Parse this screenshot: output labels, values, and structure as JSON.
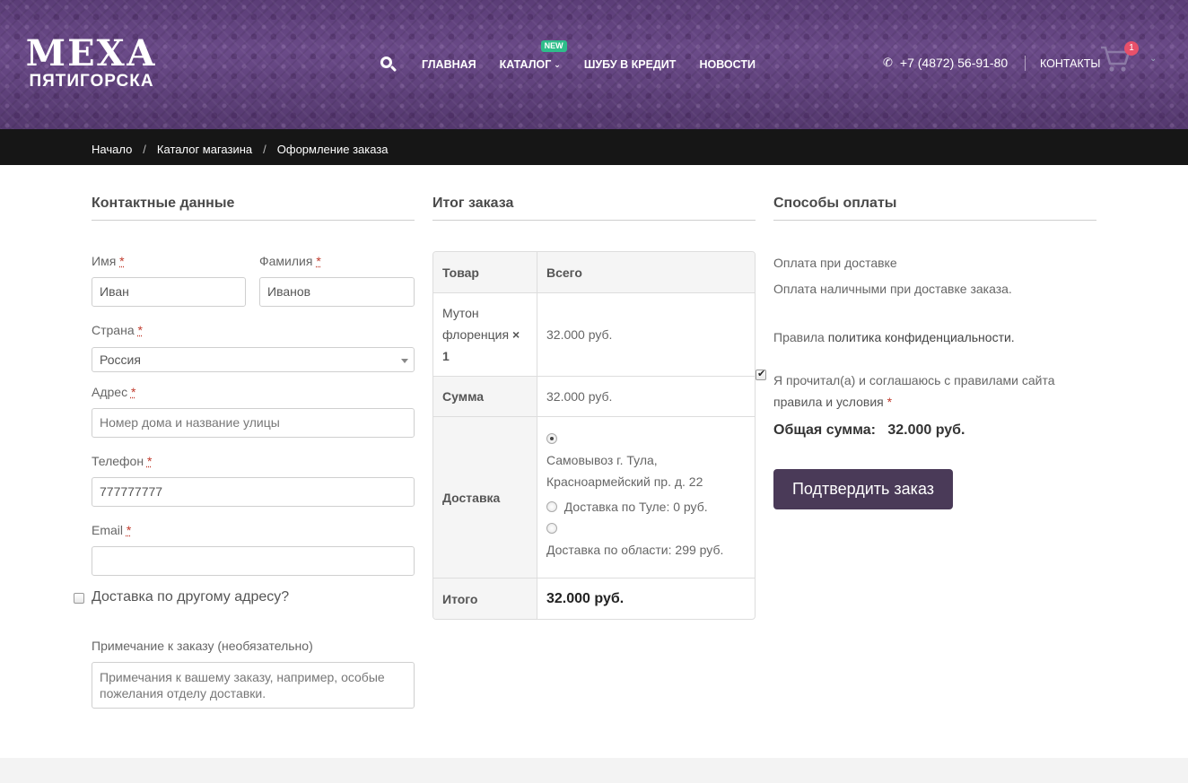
{
  "header": {
    "logo_top": "МЕХА",
    "logo_bottom": "ПЯТИГОРСКА",
    "nav": {
      "home": "ГЛАВНАЯ",
      "catalog": "КАТАЛОГ",
      "catalog_badge": "NEW",
      "credit": "ШУБУ В КРЕДИТ",
      "news": "НОВОСТИ"
    },
    "phone": "+7 (4872) 56-91-80",
    "contacts": "КОНТАКТЫ",
    "cart_count": "1",
    "icons": [
      "search-icon",
      "chevron-down-icon",
      "phone-icon",
      "cart-icon"
    ]
  },
  "breadcrumb": {
    "items": [
      "Начало",
      "Каталог магазина",
      "Оформление заказа"
    ],
    "separator": "/"
  },
  "contact": {
    "title": "Контактные данные",
    "first_name_label": "Имя",
    "first_name_value": "Иван",
    "last_name_label": "Фамилия",
    "last_name_value": "Иванов",
    "country_label": "Страна",
    "country_value": "Россия",
    "address_label": "Адрес",
    "address_placeholder": "Номер дома и название улицы",
    "phone_label": "Телефон",
    "phone_value": "777777777",
    "email_label": "Email",
    "email_value": "",
    "required_mark": "*",
    "ship_other_label": "Доставка по другому адресу?",
    "note_label": "Примечание к заказу (необязательно)",
    "note_placeholder": "Примечания к вашему заказу, например, особые пожелания отделу доставки."
  },
  "order": {
    "title": "Итог заказа",
    "col_product": "Товар",
    "col_total": "Всего",
    "product_name_line1": "Мутон",
    "product_name_line2": "флоренция",
    "product_qty_x": "×",
    "product_qty": "1",
    "product_price": "32.000  руб.",
    "subtotal_label": "Сумма",
    "subtotal_value": "32.000  руб.",
    "shipping_label": "Доставка",
    "shipping_option_1_line1": "Самовывоз г. Тула,",
    "shipping_option_1_line2": "Красноармейский пр. д. 22",
    "shipping_option_2": "Доставка по Туле: 0  руб.",
    "shipping_option_3": "Доставка по области: 299  руб.",
    "total_label": "Итого",
    "total_value": "32.000  руб."
  },
  "payment": {
    "title": "Способы оплаты",
    "method_name": "Оплата при доставке",
    "method_desc": "Оплата наличными при доставке заказа.",
    "privacy_prefix": "Правила",
    "privacy_link": "политика конфиденциальности.",
    "terms_line1": "Я прочитал(а) и соглашаюсь с правилами сайта",
    "terms_link": "правила и условия",
    "terms_req": "*",
    "grand_total_label": "Общая сумма:",
    "grand_total_value": "32.000  руб.",
    "confirm_button": "Подтвердить заказ"
  },
  "colors": {
    "header_purple": "#5b3d77",
    "breadcrumb_bg": "#161616",
    "button_bg": "#4a3a58",
    "badge_green": "#2ebd8a",
    "cart_badge": "#e8506a",
    "required": "#c0392b"
  }
}
